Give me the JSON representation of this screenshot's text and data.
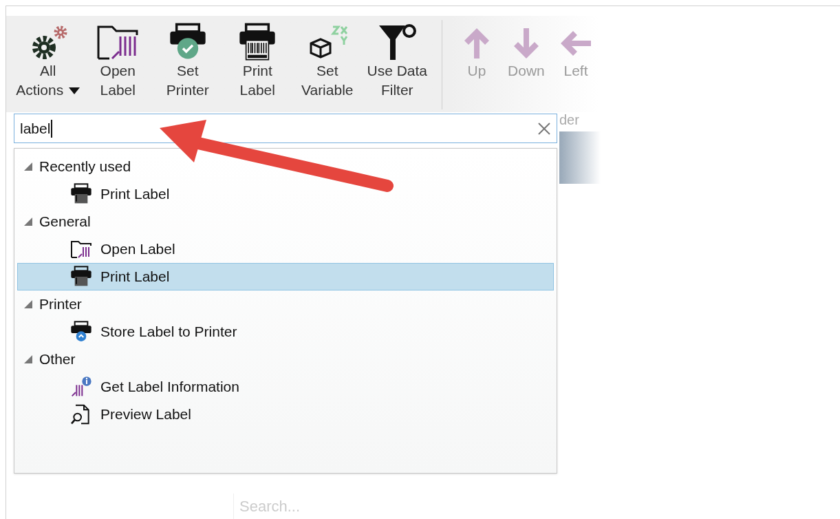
{
  "toolbar": {
    "buttons": [
      {
        "kind": "all-actions",
        "label": "All Actions",
        "disabled": false
      },
      {
        "kind": "open-label",
        "label": "Open Label",
        "disabled": false
      },
      {
        "kind": "set-printer",
        "label": "Set Printer",
        "disabled": false
      },
      {
        "kind": "print-label",
        "label": "Print Label",
        "disabled": false
      },
      {
        "kind": "set-variable",
        "label": "Set Variable",
        "disabled": false
      },
      {
        "kind": "data-filter",
        "label": "Use Data Filter",
        "disabled": false
      },
      {
        "kind": "separator"
      },
      {
        "kind": "up",
        "label": "Up",
        "disabled": true
      },
      {
        "kind": "down",
        "label": "Down",
        "disabled": true
      },
      {
        "kind": "left",
        "label": "Left",
        "disabled": true
      }
    ]
  },
  "search": {
    "value": "label"
  },
  "background": {
    "column_label": "der",
    "search_placeholder": "Search..."
  },
  "results": [
    {
      "label": "Recently used",
      "expanded": true,
      "children": [
        {
          "kind": "print-label",
          "label": "Print Label",
          "selected": false
        }
      ]
    },
    {
      "label": "General",
      "expanded": true,
      "children": [
        {
          "kind": "open-label",
          "label": "Open Label",
          "selected": false
        },
        {
          "kind": "print-label",
          "label": "Print Label",
          "selected": true
        }
      ]
    },
    {
      "label": "Printer",
      "expanded": true,
      "children": [
        {
          "kind": "store-label",
          "label": "Store Label to Printer",
          "selected": false
        }
      ]
    },
    {
      "label": "Other",
      "expanded": true,
      "children": [
        {
          "kind": "label-info",
          "label": "Get Label Information",
          "selected": false
        },
        {
          "kind": "preview-label",
          "label": "Preview Label",
          "selected": false
        }
      ]
    }
  ]
}
